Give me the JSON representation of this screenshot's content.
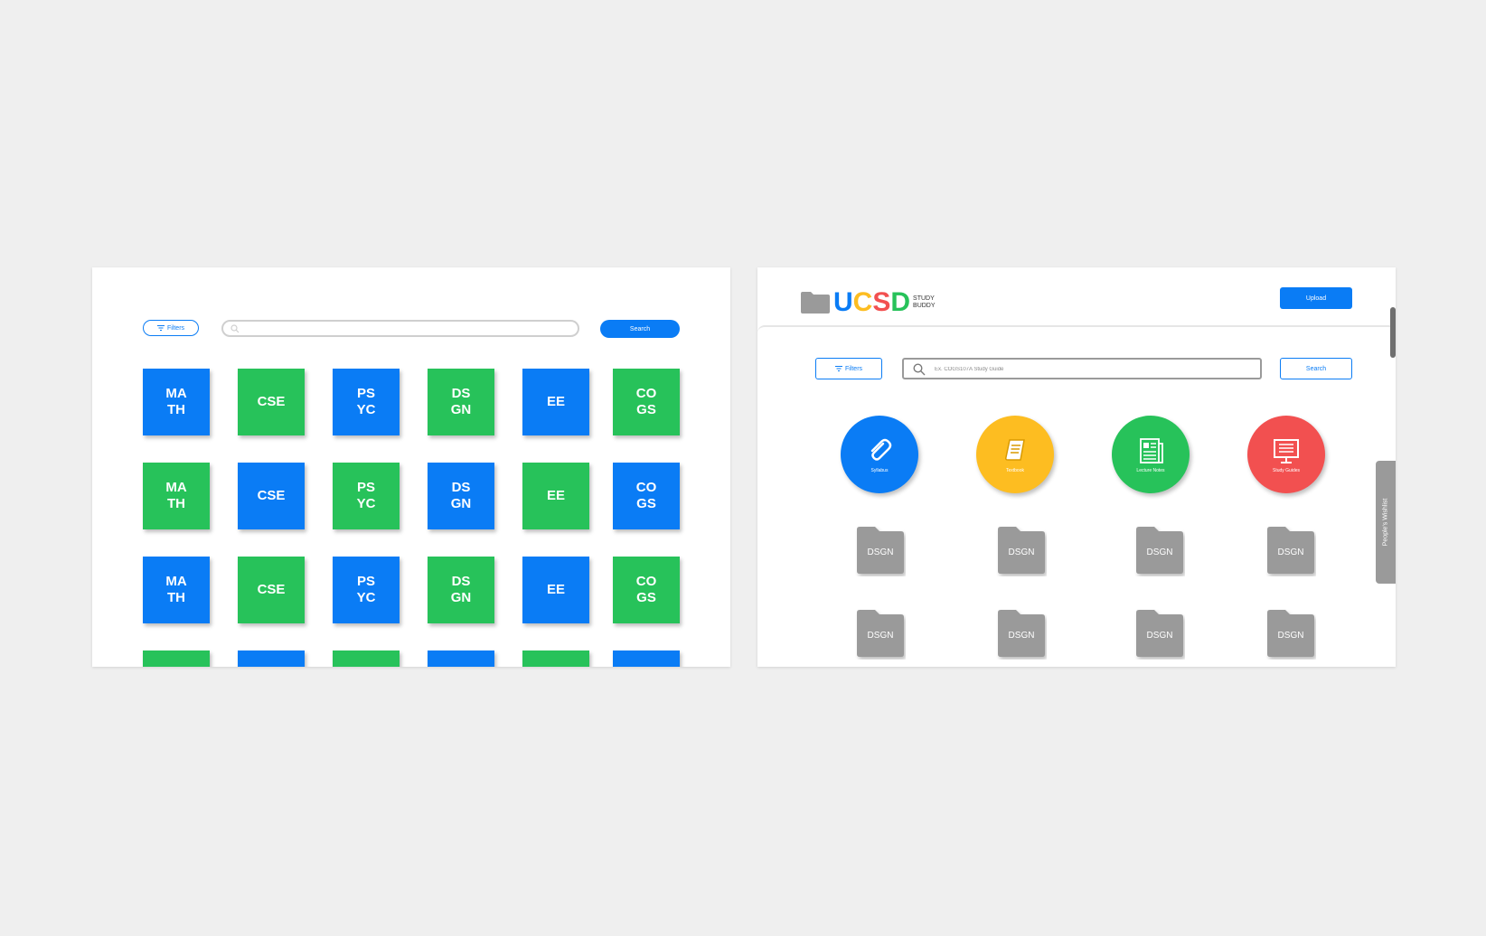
{
  "left": {
    "filters_label": "Filters",
    "search_label": "Search",
    "tiles": [
      [
        "MA\nTH",
        "CSE",
        "PS\nYC",
        "DS\nGN",
        "EE",
        "CO\nGS"
      ],
      [
        "MA\nTH",
        "CSE",
        "PS\nYC",
        "DS\nGN",
        "EE",
        "CO\nGS"
      ],
      [
        "MA\nTH",
        "CSE",
        "PS\nYC",
        "DS\nGN",
        "EE",
        "CO\nGS"
      ],
      [
        "",
        "",
        "",
        "",
        "",
        ""
      ]
    ]
  },
  "right": {
    "logo": {
      "text": "UCSD",
      "sub_line1": "STUDY",
      "sub_line2": "BUDDY"
    },
    "upload_label": "Upload",
    "filters_label": "Filters",
    "search_placeholder": "Ex. COGS107A Study Guide",
    "search_label": "Search",
    "categories": [
      {
        "label": "Syllabus",
        "icon": "paperclip-icon",
        "color": "#0a7cf5"
      },
      {
        "label": "Textbook",
        "icon": "book-icon",
        "color": "#fdbd21"
      },
      {
        "label": "Lecture Notes",
        "icon": "notes-icon",
        "color": "#27c25a"
      },
      {
        "label": "Study Guides",
        "icon": "monitor-icon",
        "color": "#f25050"
      }
    ],
    "folders": [
      "DSGN",
      "DSGN",
      "DSGN",
      "DSGN",
      "DSGN",
      "DSGN",
      "DSGN",
      "DSGN"
    ],
    "wishlist_label": "People's Wishlist"
  },
  "colors": {
    "blue": "#0a7cf5",
    "green": "#27c25a",
    "yellow": "#fdbd21",
    "red": "#f25050",
    "folder_gray": "#9a9a9a"
  }
}
